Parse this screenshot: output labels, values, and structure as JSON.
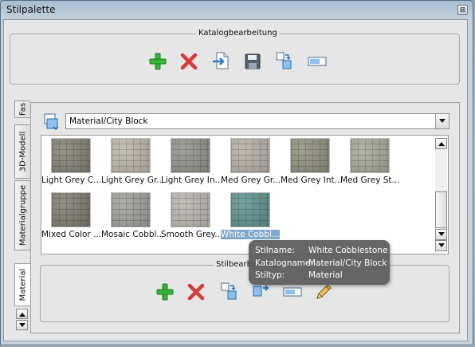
{
  "window": {
    "title": "Stilpalette",
    "close_glyph": "⊠"
  },
  "catalog_edit": {
    "label": "Katalogbearbeitung",
    "buttons": [
      {
        "icon": "add-icon"
      },
      {
        "icon": "delete-icon"
      },
      {
        "icon": "import-icon"
      },
      {
        "icon": "save-icon"
      },
      {
        "icon": "copy-style-icon"
      },
      {
        "icon": "rename-icon"
      }
    ]
  },
  "tabs": [
    {
      "label": "Fas"
    },
    {
      "label": "3D-Modell"
    },
    {
      "label": "Materialgruppe"
    },
    {
      "label": "Material",
      "active": true
    }
  ],
  "category_select": {
    "value": "Material/City Block"
  },
  "materials": [
    {
      "label": "Light Grey C...",
      "swatch": "#7f7d72"
    },
    {
      "label": "Light Grey Gr...",
      "swatch": "#b9b2a6"
    },
    {
      "label": "Light Grey In...",
      "swatch": "#8e8e88"
    },
    {
      "label": "Med Grey Gr...",
      "swatch": "#b2ada3"
    },
    {
      "label": "Med Grey Int...",
      "swatch": "#8c8c7c"
    },
    {
      "label": "Med Grey St...",
      "swatch": "#a3a596"
    },
    {
      "label": "Mixed Color ...",
      "swatch": "#7a776d"
    },
    {
      "label": "Mosaic Cobbl...",
      "swatch": "#9b9b97"
    },
    {
      "label": "Smooth Grey...",
      "swatch": "#b6b3ad"
    },
    {
      "label": "White Cobbl...",
      "swatch": "#5b8e8a",
      "selected": true
    }
  ],
  "style_edit": {
    "label": "Stilbearbeitung",
    "buttons": [
      {
        "icon": "add-icon"
      },
      {
        "icon": "delete-icon"
      },
      {
        "icon": "copy-style-icon"
      },
      {
        "icon": "paste-style-icon"
      },
      {
        "icon": "rename-icon"
      },
      {
        "icon": "edit-pencil-icon"
      }
    ]
  },
  "tooltip": {
    "rows": [
      {
        "key": "Stilname:",
        "value": "White Cobblestone"
      },
      {
        "key": "Katalogname:",
        "value": "Material/City Block"
      },
      {
        "key": "Stiltyp:",
        "value": "Material"
      }
    ]
  },
  "colors": {
    "add": "#2faa2f",
    "delete": "#d83a3a",
    "selection": "#7fa8c9",
    "tooltip_bg": "#5a5a5a"
  }
}
